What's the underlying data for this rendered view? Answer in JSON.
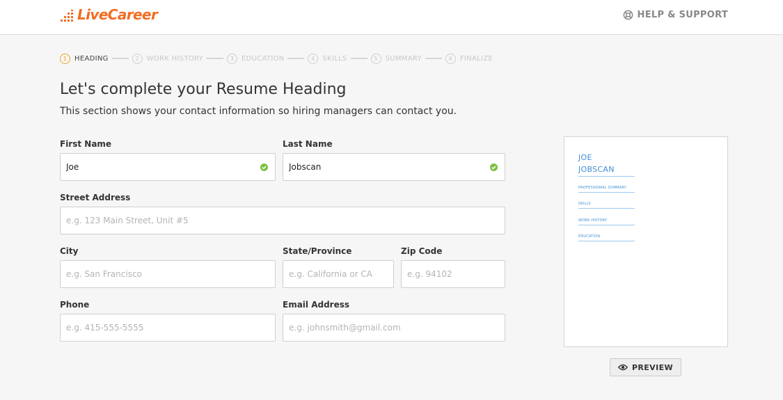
{
  "header": {
    "logo_text": "LiveCareer",
    "help_label": "HELP & SUPPORT",
    "help_icon": "lifebuoy-icon"
  },
  "colors": {
    "brand_orange": "#f26d21",
    "step_active": "#f0a21e",
    "preview_blue": "#3f8fd4",
    "valid_green": "#7bc143"
  },
  "steps": [
    {
      "number": "1",
      "label": "HEADING",
      "active": true
    },
    {
      "number": "2",
      "label": "WORK HISTORY",
      "active": false
    },
    {
      "number": "3",
      "label": "EDUCATION",
      "active": false
    },
    {
      "number": "4",
      "label": "SKILLS",
      "active": false
    },
    {
      "number": "5",
      "label": "SUMMARY",
      "active": false
    },
    {
      "number": "6",
      "label": "FINALIZE",
      "active": false
    }
  ],
  "main": {
    "title": "Let's complete your Resume Heading",
    "subtitle": "This section shows your contact information so hiring managers can contact you."
  },
  "form": {
    "first_name": {
      "label": "First Name",
      "value": "Joe",
      "placeholder": ""
    },
    "last_name": {
      "label": "Last Name",
      "value": "Jobscan",
      "placeholder": ""
    },
    "street": {
      "label": "Street Address",
      "value": "",
      "placeholder": "e.g. 123 Main Street, Unit #5"
    },
    "city": {
      "label": "City",
      "value": "",
      "placeholder": "e.g. San Francisco"
    },
    "state": {
      "label": "State/Province",
      "value": "",
      "placeholder": "e.g. California or CA"
    },
    "zip": {
      "label": "Zip Code",
      "value": "",
      "placeholder": "e.g. 94102"
    },
    "phone": {
      "label": "Phone",
      "value": "",
      "placeholder": "e.g. 415-555-5555"
    },
    "email": {
      "label": "Email Address",
      "value": "",
      "placeholder": "e.g. johnsmith@gmail.com"
    }
  },
  "preview": {
    "first_name": "JOE",
    "last_name": "JOBSCAN",
    "sections": [
      "PROFESSIONAL SUMMARY",
      "SKILLS",
      "WORK HISTORY",
      "EDUCATION"
    ],
    "button_label": "PREVIEW",
    "button_icon": "eye-icon"
  }
}
